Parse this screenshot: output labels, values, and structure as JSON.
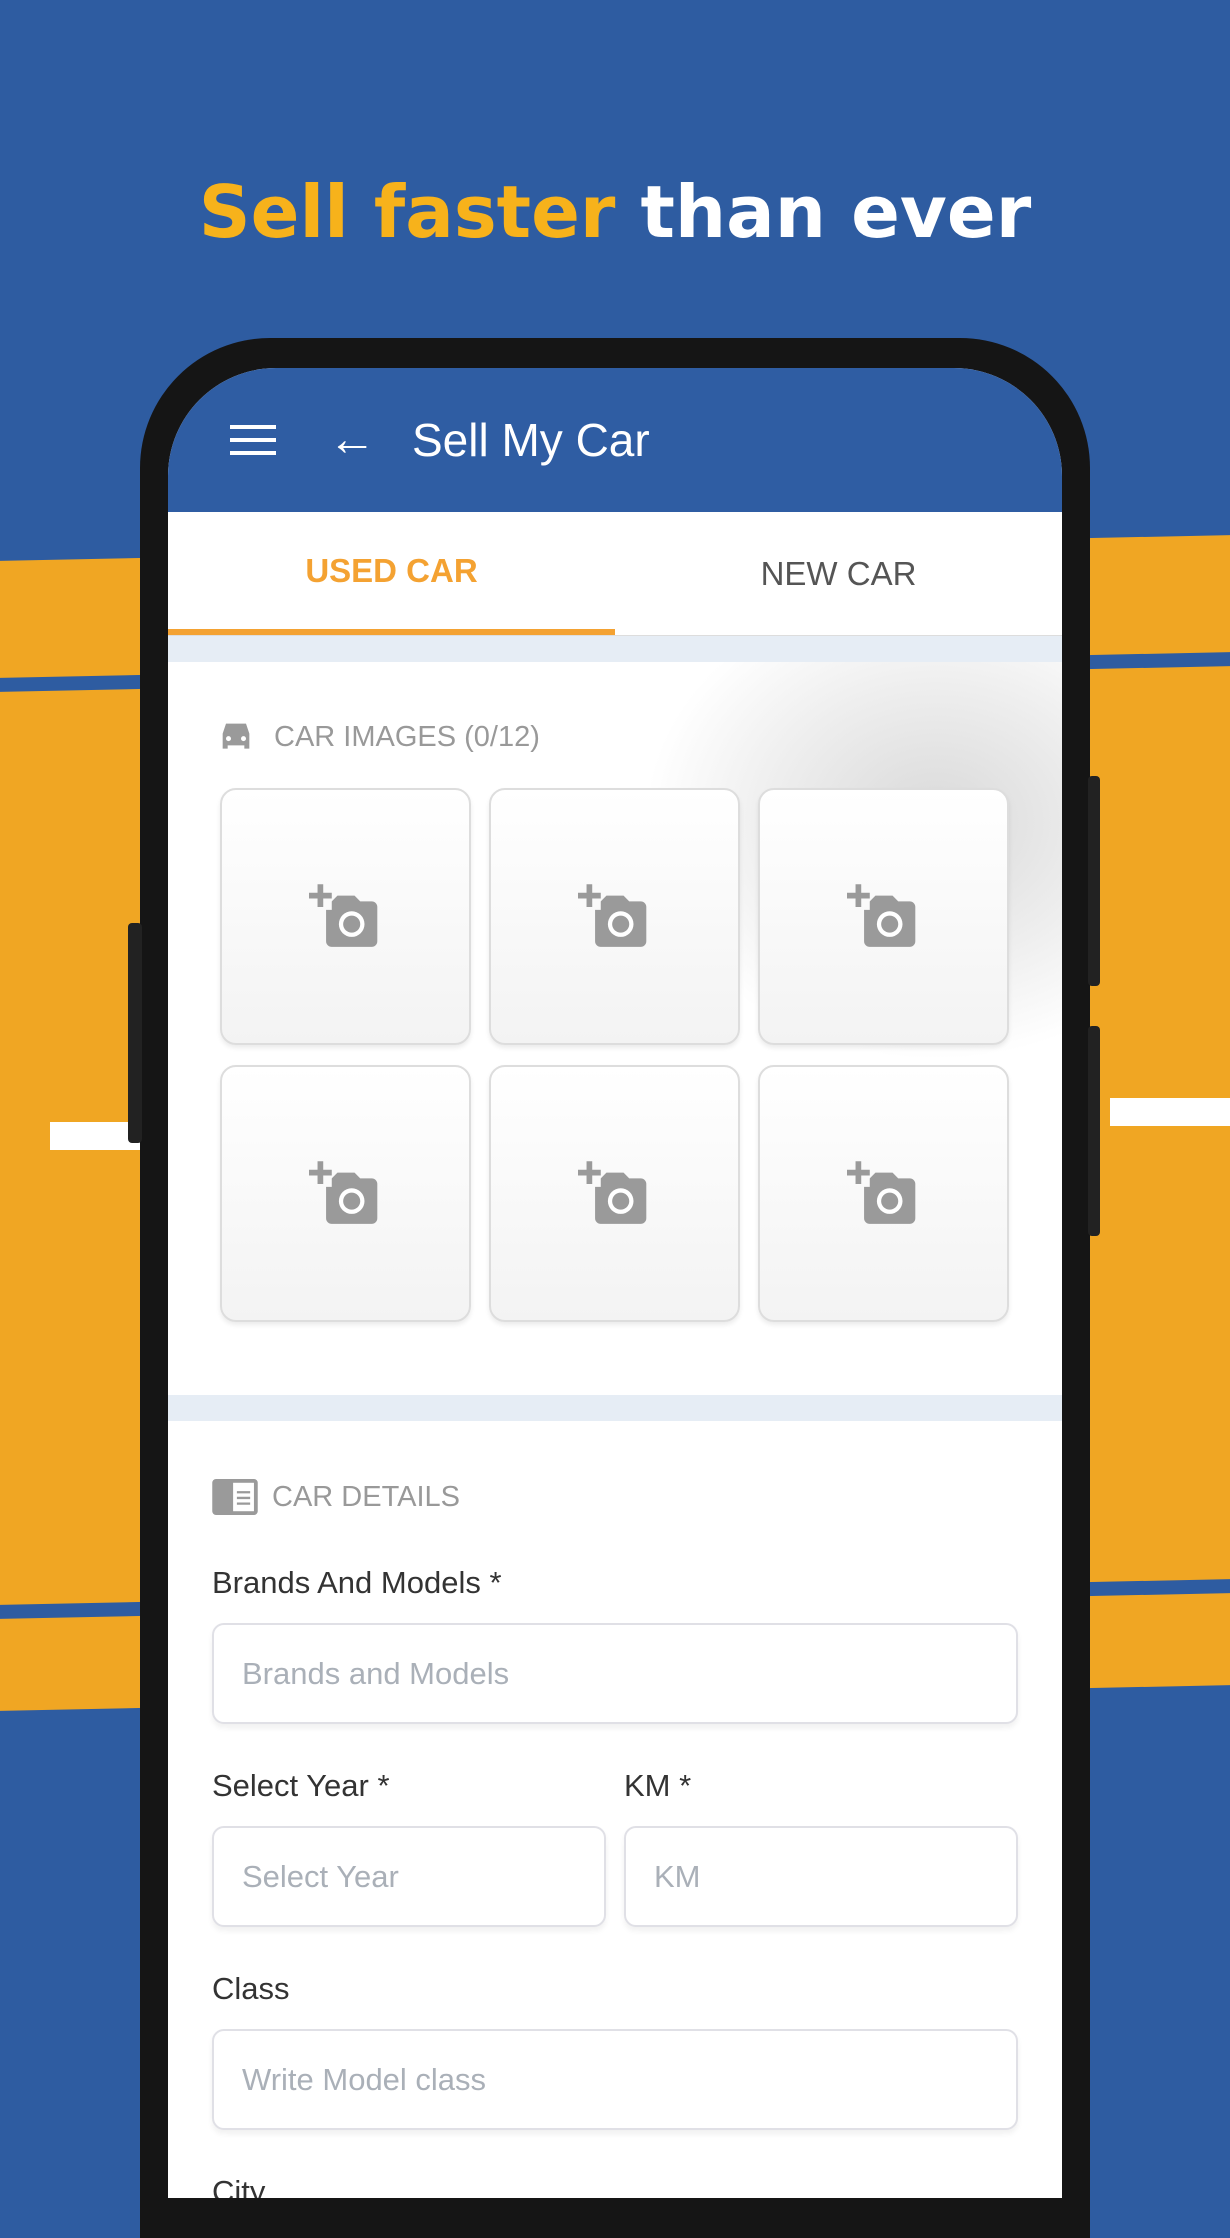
{
  "headline": {
    "highlight": "Sell faster",
    "rest": " than ever"
  },
  "colors": {
    "brand_blue": "#2f5da3",
    "accent_orange": "#f4a232",
    "headline_yellow": "#f7b21b"
  },
  "appbar": {
    "title": "Sell My Car",
    "menu_icon": "hamburger-icon",
    "back_icon": "arrow-left-icon"
  },
  "tabs": [
    {
      "label": "USED CAR",
      "active": true
    },
    {
      "label": "NEW CAR",
      "active": false
    }
  ],
  "images": {
    "header": "CAR IMAGES (0/12)",
    "icon": "car-icon",
    "tile_icon": "add-a-photo-icon",
    "tile_count": 6
  },
  "details": {
    "header": "CAR DETAILS",
    "icon": "list-card-icon",
    "brands": {
      "label": "Brands And Models *",
      "placeholder": "Brands and Models"
    },
    "year": {
      "label": "Select Year *",
      "placeholder": "Select Year"
    },
    "km": {
      "label": "KM *",
      "placeholder": "KM"
    },
    "class": {
      "label": "Class",
      "placeholder": "Write Model class"
    },
    "next_label": "City"
  }
}
